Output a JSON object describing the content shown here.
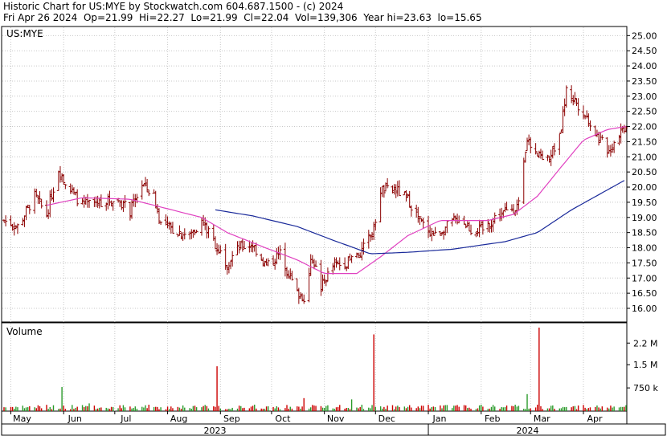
{
  "header": {
    "line1": "Historic Chart for US:MYE by Stockwatch.com 604.687.1500 - (c) 2024",
    "line2": "Fri Apr 26 2024  Op=21.99  Hi=22.27  Lo=21.99  Cl=22.04  Vol=139,306  Year hi=23.63  lo=15.65"
  },
  "colors": {
    "bar": "#8b0000",
    "ma_short": "#e040c0",
    "ma_long": "#1a2a9a",
    "volume_up": "#2a9a2a",
    "volume_down": "#cc0000",
    "grid": "#c8c8c8"
  },
  "chart_data": {
    "type": "line",
    "symbol": "US:MYE",
    "y_ticks": [
      "25.00",
      "24.50",
      "24.00",
      "23.50",
      "23.00",
      "22.50",
      "22.00",
      "21.50",
      "21.00",
      "20.50",
      "20.00",
      "19.50",
      "19.00",
      "18.50",
      "18.00",
      "17.50",
      "17.00",
      "16.50",
      "16.00"
    ],
    "ylim": [
      15.55,
      25.3
    ],
    "month_labels": [
      "May",
      "Jun",
      "Jul",
      "Aug",
      "Sep",
      "Oct",
      "Nov",
      "Dec",
      "Jan",
      "Feb",
      "Mar",
      "Apr"
    ],
    "year_labels": [
      "2023",
      "2024"
    ],
    "x_range": [
      "2023-04-27",
      "2024-04-26"
    ],
    "price_key_points": [
      [
        "2023-04-27",
        18.9
      ],
      [
        "2023-05-05",
        18.7
      ],
      [
        "2023-05-15",
        19.7
      ],
      [
        "2023-05-22",
        19.1
      ],
      [
        "2023-05-29",
        20.6
      ],
      [
        "2023-06-05",
        19.9
      ],
      [
        "2023-06-12",
        19.4
      ],
      [
        "2023-06-20",
        19.5
      ],
      [
        "2023-07-03",
        19.6
      ],
      [
        "2023-07-10",
        19.2
      ],
      [
        "2023-07-17",
        20.1
      ],
      [
        "2023-07-24",
        19.7
      ],
      [
        "2023-07-28",
        18.8
      ],
      [
        "2023-08-04",
        18.6
      ],
      [
        "2023-08-14",
        18.4
      ],
      [
        "2023-08-21",
        18.9
      ],
      [
        "2023-08-28",
        18.2
      ],
      [
        "2023-09-05",
        17.5
      ],
      [
        "2023-09-12",
        18.0
      ],
      [
        "2023-09-20",
        18.1
      ],
      [
        "2023-09-28",
        17.4
      ],
      [
        "2023-10-06",
        17.8
      ],
      [
        "2023-10-16",
        16.5
      ],
      [
        "2023-10-20",
        16.4
      ],
      [
        "2023-10-25",
        17.7
      ],
      [
        "2023-10-30",
        16.7
      ],
      [
        "2023-11-06",
        17.4
      ],
      [
        "2023-11-14",
        17.5
      ],
      [
        "2023-11-22",
        17.8
      ],
      [
        "2023-11-30",
        18.6
      ],
      [
        "2023-12-04",
        19.9
      ],
      [
        "2023-12-13",
        19.9
      ],
      [
        "2023-12-20",
        19.6
      ],
      [
        "2023-12-28",
        18.8
      ],
      [
        "2024-01-05",
        18.4
      ],
      [
        "2024-01-12",
        18.7
      ],
      [
        "2024-01-19",
        19.0
      ],
      [
        "2024-01-26",
        18.6
      ],
      [
        "2024-02-02",
        18.6
      ],
      [
        "2024-02-09",
        19.0
      ],
      [
        "2024-02-16",
        19.2
      ],
      [
        "2024-02-23",
        19.4
      ],
      [
        "2024-02-28",
        21.5
      ],
      [
        "2024-03-05",
        21.2
      ],
      [
        "2024-03-11",
        20.9
      ],
      [
        "2024-03-18",
        21.6
      ],
      [
        "2024-03-22",
        23.2
      ],
      [
        "2024-03-28",
        22.8
      ],
      [
        "2024-04-04",
        22.2
      ],
      [
        "2024-04-10",
        21.6
      ],
      [
        "2024-04-16",
        21.2
      ],
      [
        "2024-04-22",
        21.8
      ],
      [
        "2024-04-26",
        22.04
      ]
    ],
    "ma_short_points": [
      [
        "2023-05-22",
        19.4
      ],
      [
        "2023-06-12",
        19.65
      ],
      [
        "2023-07-10",
        19.6
      ],
      [
        "2023-07-31",
        19.3
      ],
      [
        "2023-08-21",
        19.0
      ],
      [
        "2023-09-05",
        18.5
      ],
      [
        "2023-09-25",
        18.05
      ],
      [
        "2023-10-16",
        17.6
      ],
      [
        "2023-11-01",
        17.15
      ],
      [
        "2023-11-20",
        17.15
      ],
      [
        "2023-12-04",
        17.7
      ],
      [
        "2023-12-20",
        18.4
      ],
      [
        "2024-01-08",
        18.9
      ],
      [
        "2024-02-05",
        18.9
      ],
      [
        "2024-02-20",
        19.1
      ],
      [
        "2024-03-05",
        19.7
      ],
      [
        "2024-03-18",
        20.6
      ],
      [
        "2024-04-01",
        21.55
      ],
      [
        "2024-04-15",
        21.9
      ],
      [
        "2024-04-26",
        22.0
      ]
    ],
    "ma_long_points": [
      [
        "2023-08-29",
        19.25
      ],
      [
        "2023-09-20",
        19.05
      ],
      [
        "2023-10-16",
        18.7
      ],
      [
        "2023-11-06",
        18.25
      ],
      [
        "2023-11-28",
        17.8
      ],
      [
        "2023-12-20",
        17.85
      ],
      [
        "2024-01-15",
        17.95
      ],
      [
        "2024-02-15",
        18.2
      ],
      [
        "2024-03-05",
        18.5
      ],
      [
        "2024-03-25",
        19.25
      ],
      [
        "2024-04-26",
        20.25
      ]
    ],
    "volume": {
      "label": "Volume",
      "y_ticks": [
        "2.2 M",
        "1.5 M",
        "750 k"
      ],
      "ylim": [
        0,
        2700000
      ],
      "spikes": [
        [
          "2023-05-31",
          780000
        ],
        [
          "2023-08-30",
          1450000
        ],
        [
          "2023-11-30",
          2480000
        ],
        [
          "2024-03-06",
          2700000
        ],
        [
          "2024-02-28",
          550000
        ],
        [
          "2023-11-17",
          380000
        ],
        [
          "2023-06-16",
          250000
        ],
        [
          "2023-10-20",
          420000
        ]
      ]
    }
  }
}
